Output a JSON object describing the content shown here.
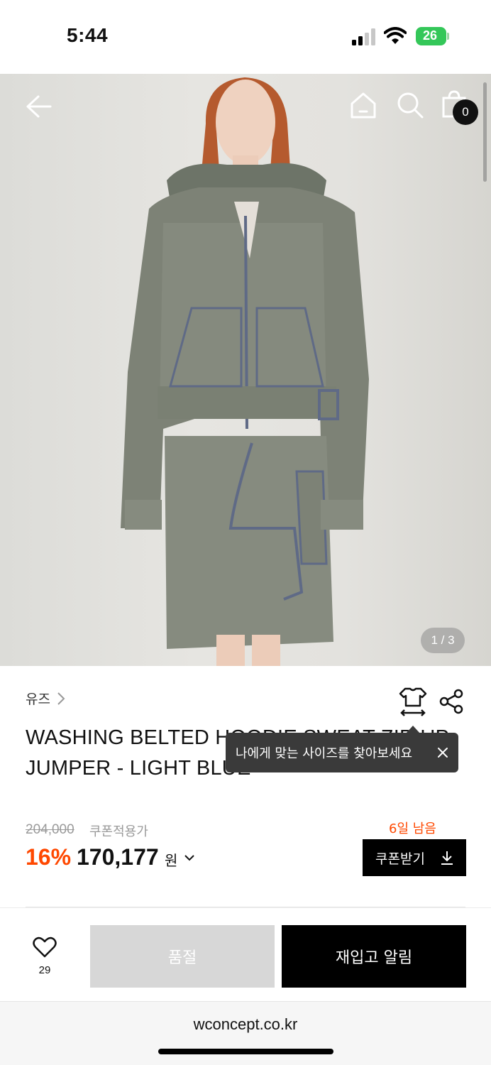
{
  "status_bar": {
    "time": "5:44",
    "battery": "26",
    "icons": [
      "signal-icon",
      "wifi-icon",
      "battery-icon"
    ]
  },
  "header": {
    "icons": [
      "back-arrow-icon",
      "home-icon",
      "search-icon",
      "shopping-bag-icon"
    ],
    "bag_count": "0"
  },
  "gallery": {
    "page_indicator": "1 / 3",
    "current_page": 1,
    "total_pages": 3
  },
  "product": {
    "brand": "유즈",
    "title": "WASHING BELTED HOODIE SWEAT ZIP-UP JUMPER - LIGHT BLUE",
    "original_price": "204,000",
    "coupon_price_label": "쿠폰적용가",
    "discount_rate": "16%",
    "sale_price": "170,177",
    "price_unit": "원",
    "days_left": "6일 남음",
    "coupon_button_label": "쿠폰받기"
  },
  "tooltip": {
    "text": "나에게 맞는 사이즈를 찾아보세요"
  },
  "actions": {
    "wish_count": "29",
    "soldout_label": "품절",
    "restock_label": "재입고 알림"
  },
  "browser": {
    "url": "wconcept.co.kr"
  },
  "colors": {
    "accent": "#ff4800",
    "primary_button": "#000000",
    "disabled_button": "#d7d7d7",
    "tooltip_bg": "#3a3a3a",
    "battery": "#34c759"
  }
}
